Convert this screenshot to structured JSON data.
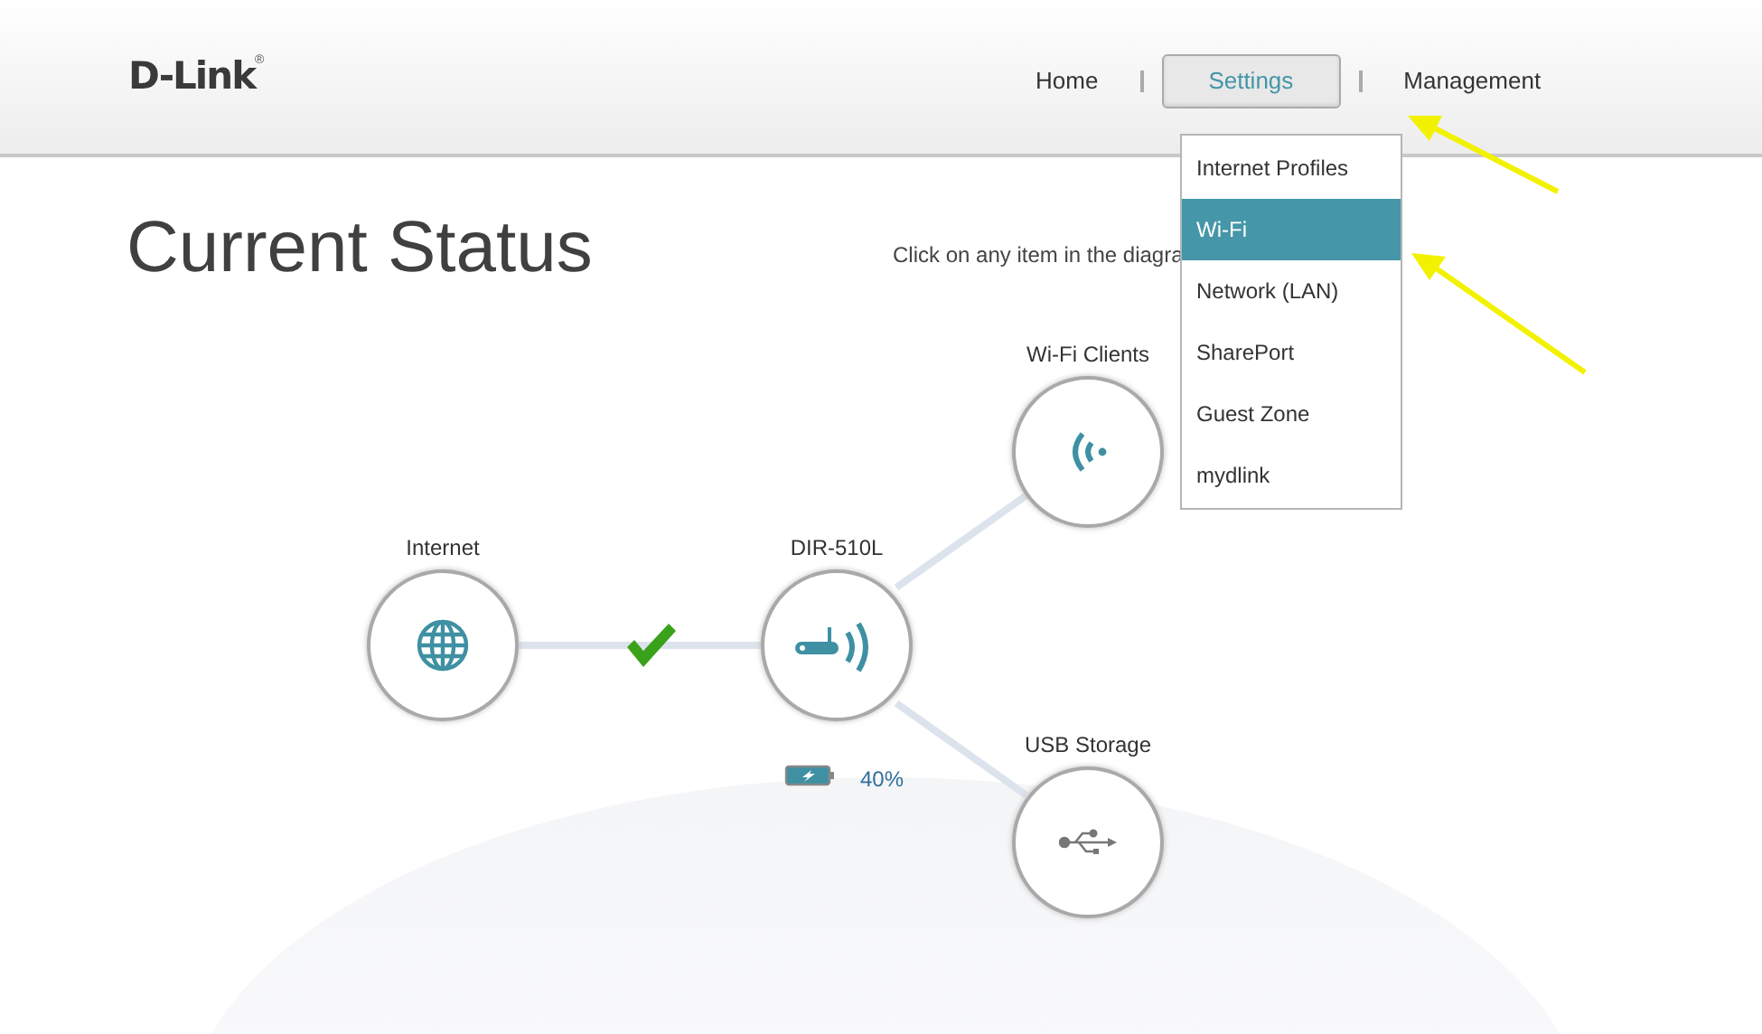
{
  "header": {
    "logo": "D-Link",
    "logo_mark": "®"
  },
  "nav": [
    {
      "label": "Home",
      "selected": false
    },
    {
      "label": "Settings",
      "selected": true
    },
    {
      "label": "Management",
      "selected": false
    }
  ],
  "dropdown": [
    {
      "label": "Internet Profiles",
      "selected": false
    },
    {
      "label": "Wi-Fi",
      "selected": true
    },
    {
      "label": "Network (LAN)",
      "selected": false
    },
    {
      "label": "SharePort",
      "selected": false
    },
    {
      "label": "Guest Zone",
      "selected": false
    },
    {
      "label": "mydlink",
      "selected": false
    }
  ],
  "title": "Current Status",
  "hint": "Click on any item in the diagra",
  "diagram": {
    "nodes": [
      {
        "kind": "internet",
        "label": "Internet"
      },
      {
        "kind": "router",
        "label": "DIR-510L",
        "battery": "40%"
      },
      {
        "kind": "wifi",
        "label": "Wi-Fi Clients"
      },
      {
        "kind": "usb",
        "label": "USB Storage"
      }
    ],
    "internet_connected": true
  }
}
